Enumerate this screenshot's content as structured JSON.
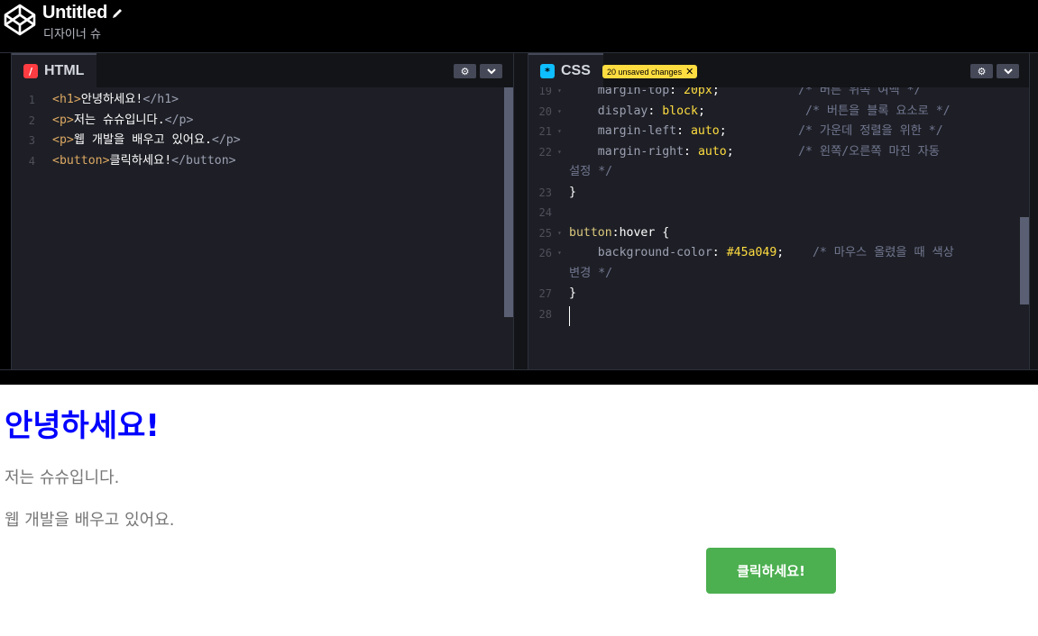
{
  "header": {
    "title": "Untitled",
    "author": "디자이너 슈"
  },
  "html_pane": {
    "tab_label": "HTML",
    "lines": [
      {
        "num": "1",
        "parts": [
          [
            "tag",
            "<h1>"
          ],
          [
            "wht",
            "안녕하세요!"
          ],
          [
            "tagc",
            "</h1>"
          ]
        ]
      },
      {
        "num": "2",
        "parts": [
          [
            "tag",
            "<p>"
          ],
          [
            "wht",
            "저는 슈슈입니다."
          ],
          [
            "tagc",
            "</p>"
          ]
        ]
      },
      {
        "num": "3",
        "parts": [
          [
            "tag",
            "<p>"
          ],
          [
            "wht",
            "웹 개발을 배우고 있어요."
          ],
          [
            "tagc",
            "</p>"
          ]
        ]
      },
      {
        "num": "4",
        "parts": [
          [
            "tag",
            "<button>"
          ],
          [
            "wht",
            "클릭하세요!"
          ],
          [
            "tagc",
            "</button>"
          ]
        ]
      }
    ]
  },
  "css_pane": {
    "tab_label": "CSS",
    "unsaved_badge": "20 unsaved changes",
    "lines": [
      {
        "num": "19",
        "fold": true,
        "parts": [
          [
            "prop",
            "    margin-top"
          ],
          [
            "wht",
            ": "
          ],
          [
            "pnum",
            "20px"
          ],
          [
            "wht",
            ";"
          ],
          [
            "comment",
            "           /* 버튼 위쪽 여백 */"
          ]
        ]
      },
      {
        "num": "20",
        "fold": true,
        "parts": [
          [
            "prop",
            "    display"
          ],
          [
            "wht",
            ": "
          ],
          [
            "pval",
            "block"
          ],
          [
            "wht",
            ";"
          ],
          [
            "comment",
            "              /* 버튼을 블록 요소로 */"
          ]
        ]
      },
      {
        "num": "21",
        "fold": true,
        "parts": [
          [
            "prop",
            "    margin-left"
          ],
          [
            "wht",
            ": "
          ],
          [
            "pval",
            "auto"
          ],
          [
            "wht",
            ";"
          ],
          [
            "comment",
            "          /* 가운데 정렬을 위한 */"
          ]
        ]
      },
      {
        "num": "22",
        "fold": true,
        "parts": [
          [
            "prop",
            "    margin-right"
          ],
          [
            "wht",
            ": "
          ],
          [
            "pval",
            "auto"
          ],
          [
            "wht",
            ";"
          ],
          [
            "comment",
            "         /* 왼쪽/오른쪽 마진 자동"
          ]
        ]
      },
      {
        "num": "",
        "fold": false,
        "parts": [
          [
            "comment",
            "설정 */"
          ]
        ]
      },
      {
        "num": "23",
        "fold": false,
        "parts": [
          [
            "wht",
            "}"
          ]
        ]
      },
      {
        "num": "24",
        "fold": false,
        "parts": [
          [
            "wht",
            ""
          ]
        ]
      },
      {
        "num": "25",
        "fold": true,
        "parts": [
          [
            "sel",
            "button"
          ],
          [
            "wht",
            ":hover {"
          ]
        ]
      },
      {
        "num": "26",
        "fold": true,
        "parts": [
          [
            "prop",
            "    background-color"
          ],
          [
            "wht",
            ": "
          ],
          [
            "pnum",
            "#45a049"
          ],
          [
            "wht",
            ";"
          ],
          [
            "comment",
            "    /* 마우스 올렸을 때 색상"
          ]
        ]
      },
      {
        "num": "",
        "fold": false,
        "parts": [
          [
            "comment",
            "변경 */"
          ]
        ]
      },
      {
        "num": "27",
        "fold": false,
        "parts": [
          [
            "wht",
            "}"
          ]
        ]
      },
      {
        "num": "28",
        "fold": false,
        "parts": [
          [
            "wht",
            ""
          ]
        ]
      }
    ]
  },
  "preview": {
    "heading": "안녕하세요!",
    "para1": "저는 슈슈입니다.",
    "para2": "웹 개발을 배우고 있어요.",
    "button": "클릭하세요!"
  },
  "colors": {
    "heading": "#0000ff",
    "button_bg": "#4caf50",
    "html_icon": "#ff3c41",
    "css_icon": "#0ebeff",
    "unsaved_badge": "#ffdd40"
  }
}
